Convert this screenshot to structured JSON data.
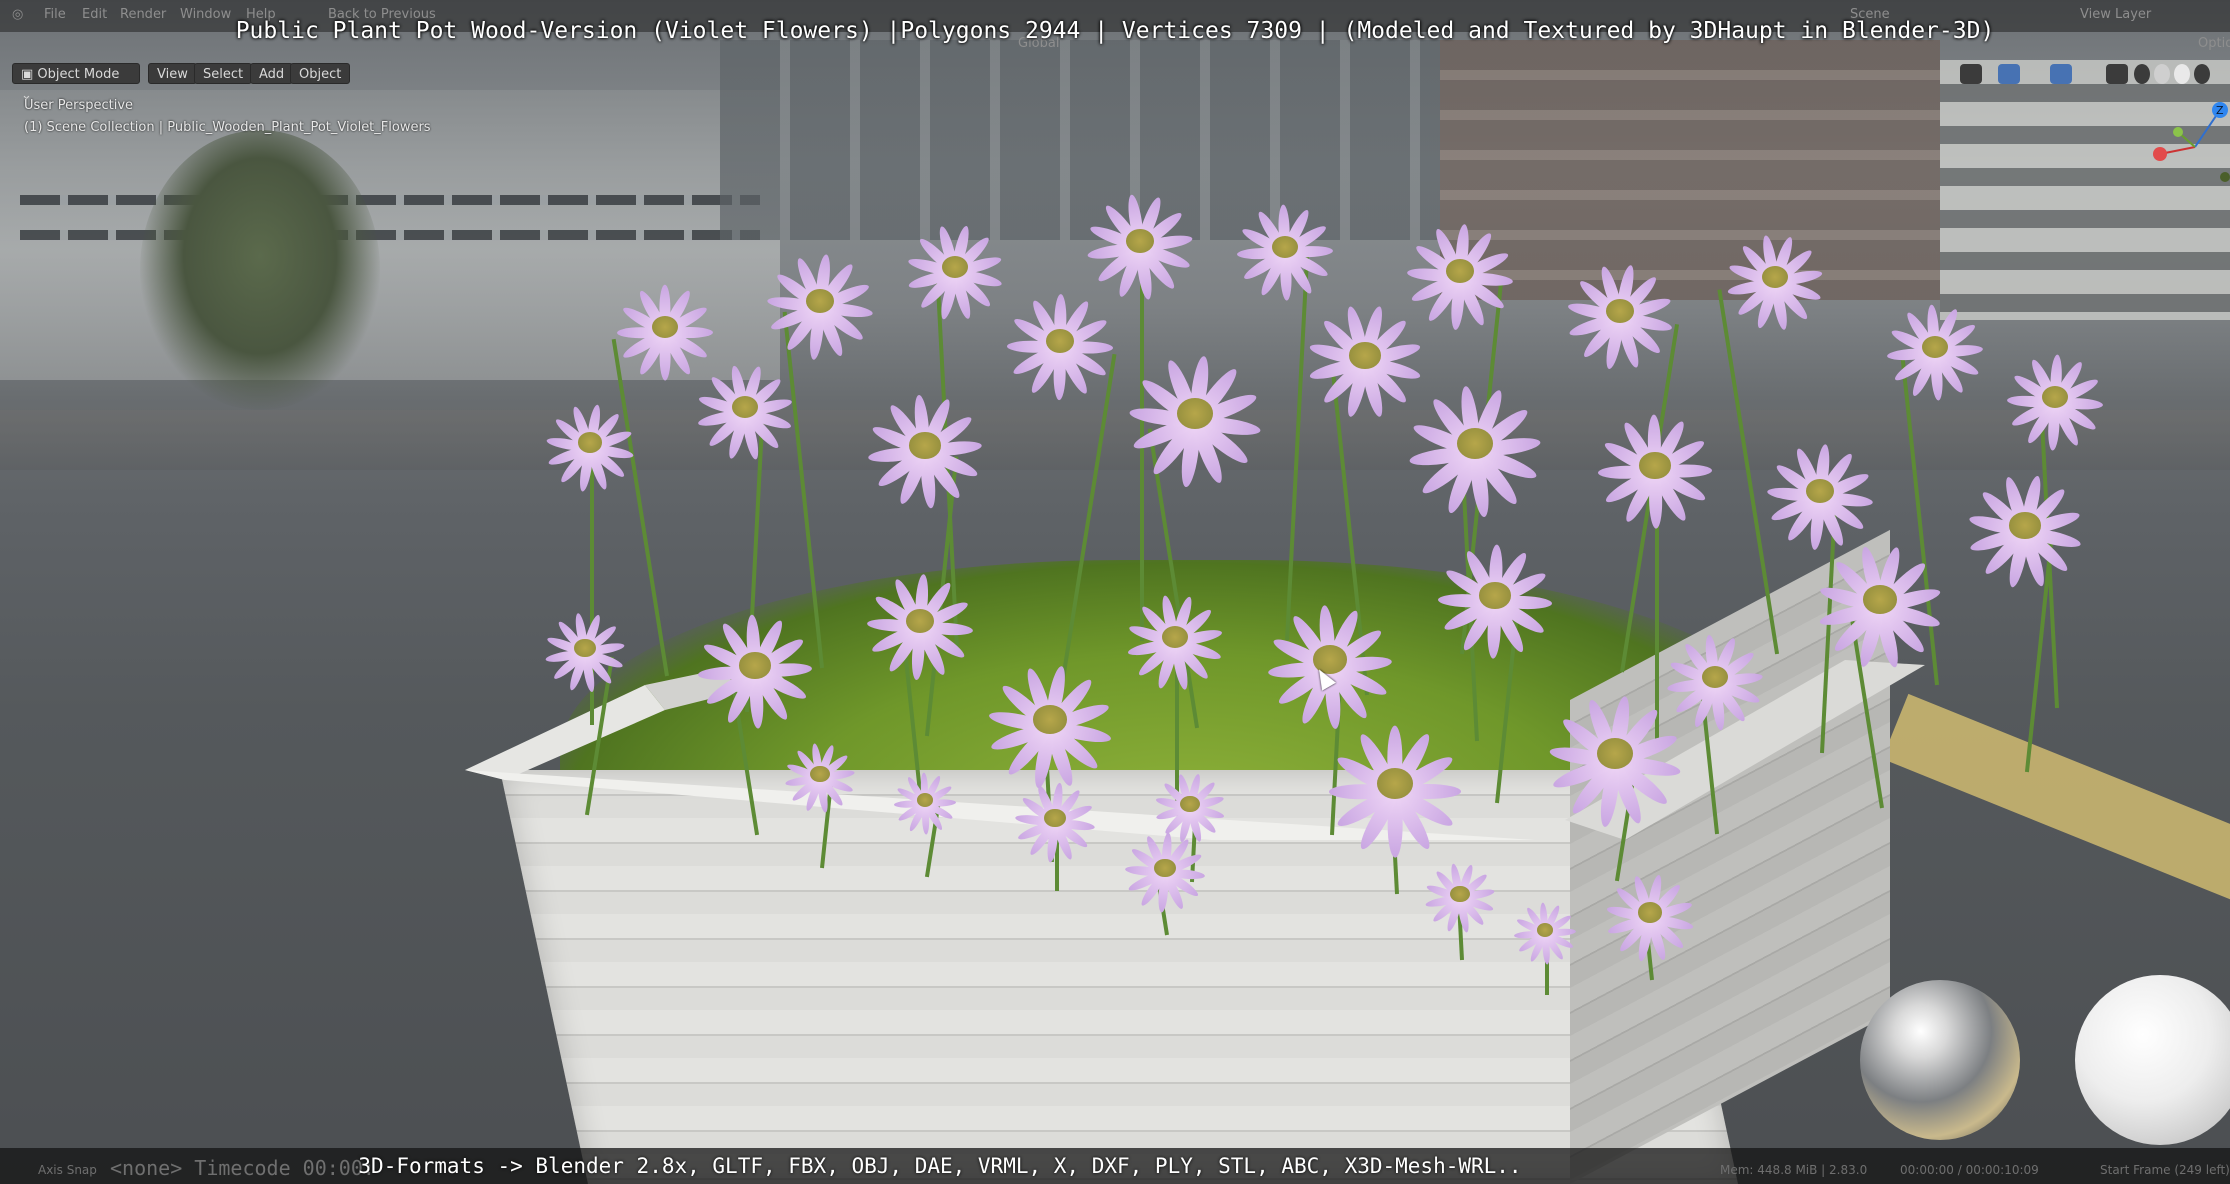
{
  "video_title": "Public Plant Pot Wood-Version (Violet Flowers) |Polygons 2944 | Vertices 7309 | (Modeled and Textured by 3DHaupt in Blender-3D)",
  "top_menu": [
    "File",
    "Edit",
    "Render",
    "Window",
    "Help"
  ],
  "back_to_previous": "Back to Previous",
  "workspace": {
    "transform_orientation": "Global",
    "scene_label": "Scene",
    "view_layer_label": "View Layer",
    "options_label": "Optio"
  },
  "header": {
    "mode": "Object Mode",
    "menus": [
      "View",
      "Select",
      "Add",
      "Object"
    ]
  },
  "viewport": {
    "perspective": "User Perspective",
    "collection": "(1) Scene Collection | Public_Wooden_Plant_Pot_Violet_Flowers"
  },
  "bottom_caption": "3D-Formats -> Blender 2.8x, GLTF, FBX, OBJ, DAE, VRML, X, DXF, PLY, STL, ABC, X3D-Mesh-WRL..",
  "status_bar": {
    "left": "Axis Snap",
    "overlay_text": "<none>   Timecode 00:00:",
    "memory": "Mem: 448.8 MiB | 2.83.0",
    "time": "00:00:00 / 00:00:10:09",
    "frame": "Start Frame (249 left)"
  },
  "colors": {
    "flower": "#d9b8ee",
    "flower_center": "#a89a45",
    "pot": "#e2e2df",
    "grass": "#7aa02e"
  }
}
